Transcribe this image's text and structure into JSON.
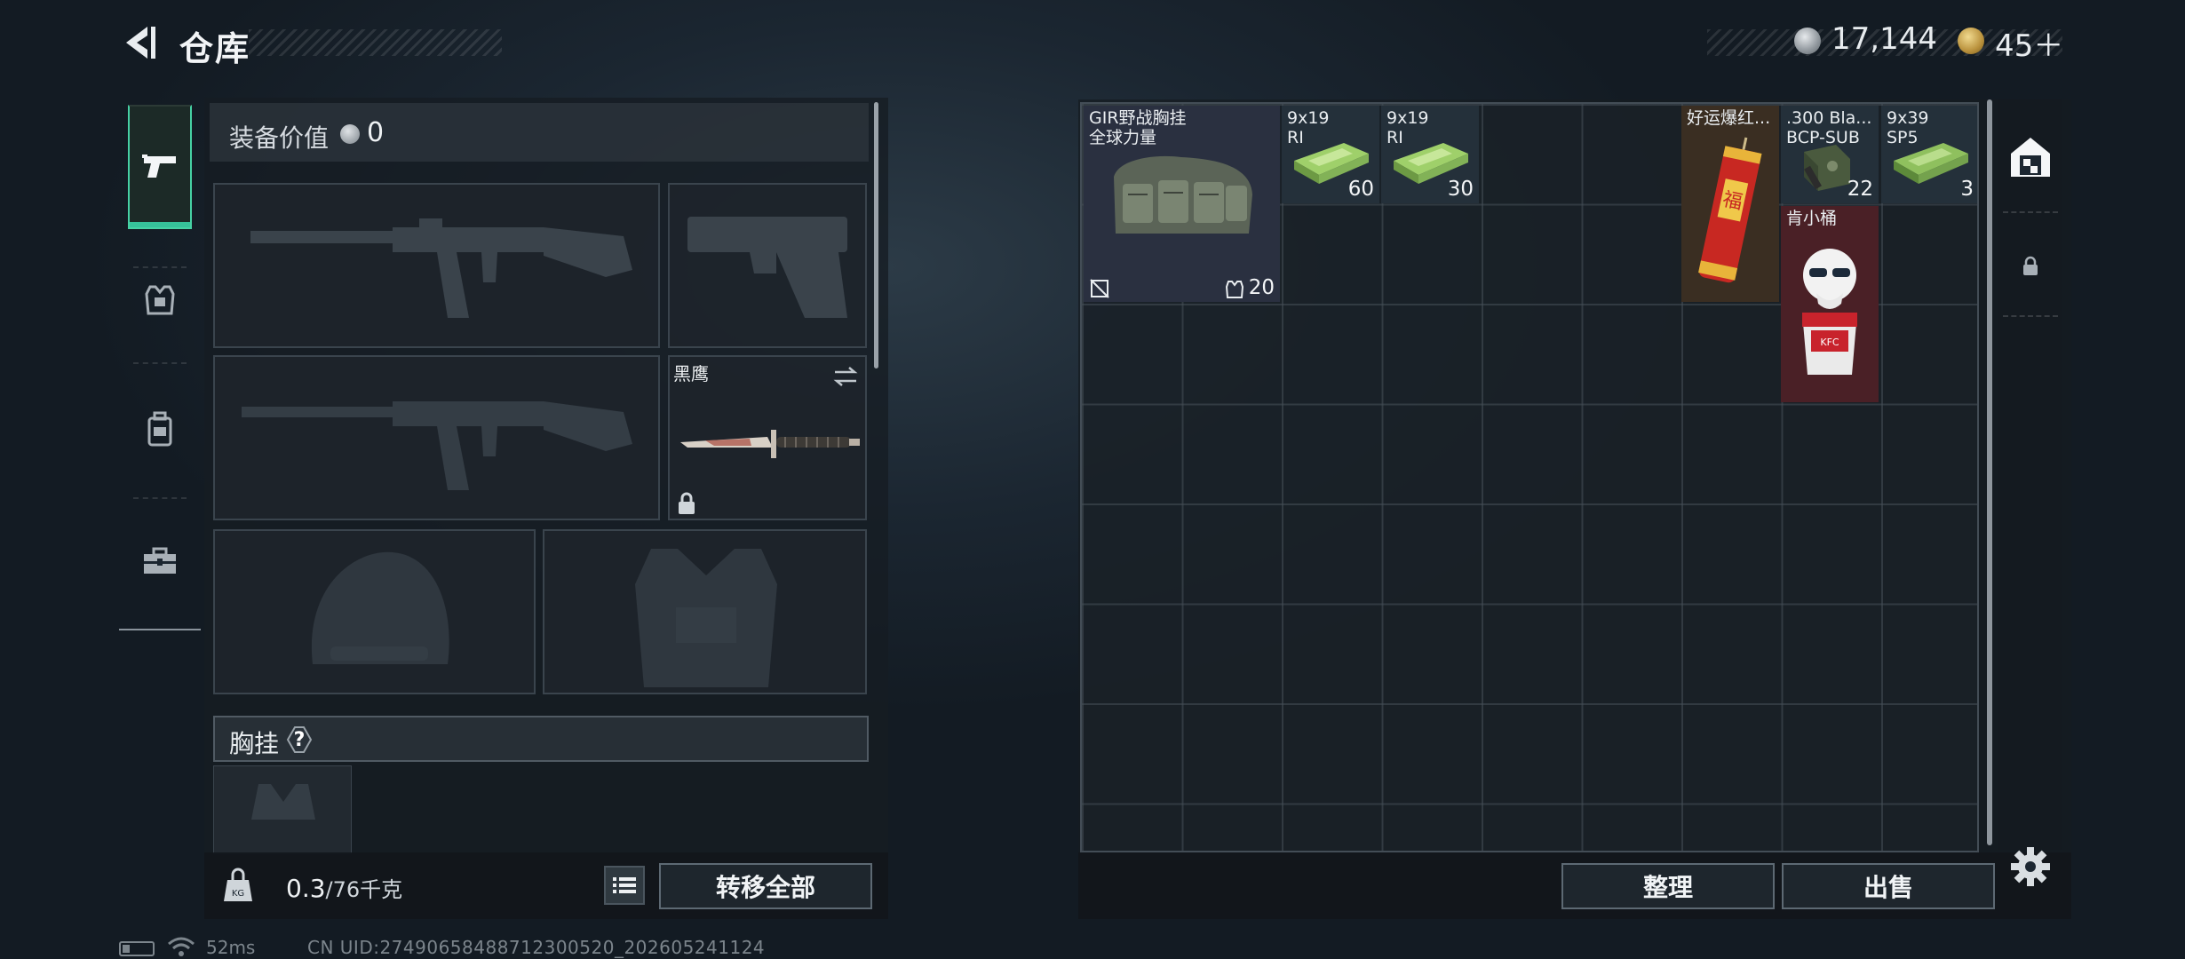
{
  "header": {
    "title": "仓库",
    "silver_amount": "17,144",
    "gold_amount": "45＋"
  },
  "equipment": {
    "value_label": "装备价值",
    "value": "0",
    "knife_name": "黑鹰",
    "chest_rig_label": "胸挂",
    "chest_rig_help": "?",
    "weight_value": "0.3",
    "weight_max": "/76千克",
    "transfer_all_label": "转移全部"
  },
  "stash": {
    "items": [
      {
        "name": "GIR野战胸挂\n全球力量",
        "qty": "20",
        "color": "#2a3040"
      },
      {
        "name": "9x19\nRI",
        "qty": "60",
        "color": "#24303a"
      },
      {
        "name": "9x19\nRI",
        "qty": "30",
        "color": "#24303a"
      },
      {
        "name": "好运爆红...",
        "qty": "",
        "color": "#3a2e22"
      },
      {
        "name": ".300 Bla...\nBCP-SUB",
        "qty": "22",
        "color": "#24303a"
      },
      {
        "name": "9x39\nSP5",
        "qty": "3",
        "color": "#24303a"
      },
      {
        "name": "肯小桶",
        "qty": "",
        "color": "#4a2026"
      }
    ],
    "sort_label": "整理",
    "sell_label": "出售"
  },
  "footer": {
    "ping": "52ms",
    "uid": "CN UID:274906584887123005​20_202605241124"
  },
  "colors": {
    "accent_green": "#46d1a4",
    "item_background_blue": "#24303a",
    "item_background_red": "#4a2026",
    "item_background_orange": "#3a2e22"
  }
}
